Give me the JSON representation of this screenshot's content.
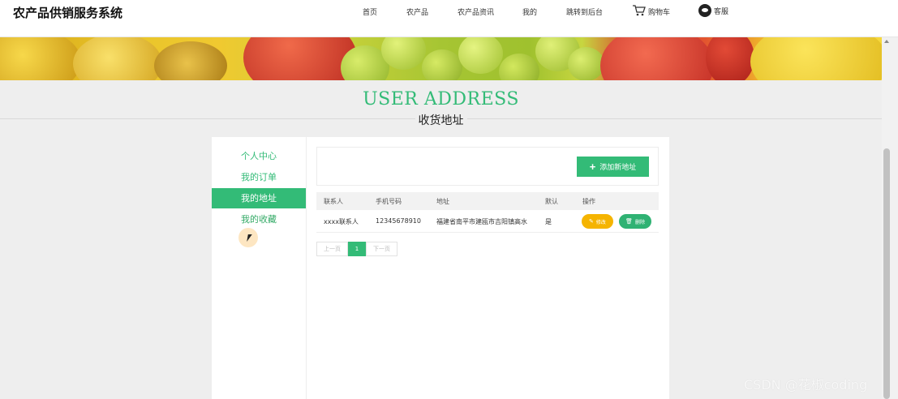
{
  "header": {
    "site_title": "农产品供销服务系统",
    "nav": [
      "首页",
      "农产品",
      "农产品资讯",
      "我的",
      "跳转到后台"
    ],
    "cart_label": "购物车",
    "service_label": "客服"
  },
  "section": {
    "title_en": "USER ADDRESS",
    "title_cn": "收货地址"
  },
  "sidebar": {
    "items": [
      {
        "label": "个人中心"
      },
      {
        "label": "我的订单"
      },
      {
        "label": "我的地址"
      },
      {
        "label": "我的收藏"
      }
    ],
    "active": "我的地址"
  },
  "toolbar": {
    "add_label": "添加新地址"
  },
  "table": {
    "headers": [
      "联系人",
      "手机号码",
      "地址",
      "默认",
      "操作"
    ],
    "rows": [
      {
        "name": "xxxx联系人",
        "phone": "12345678910",
        "address": "福建省南平市建瓯市吉阳镇高水",
        "default": "是",
        "edit_label": "修改",
        "delete_label": "删除"
      }
    ]
  },
  "pagination": {
    "prev": "上一页",
    "current": "1",
    "next": "下一页"
  },
  "watermark": "CSDN @花椒coding",
  "colors": {
    "accent": "#33bb77",
    "edit": "#f5b400",
    "delete": "#2fb273"
  },
  "icons": [
    "cart-icon",
    "chat-icon",
    "plus-icon",
    "edit-icon",
    "trash-icon",
    "cursor-icon"
  ]
}
